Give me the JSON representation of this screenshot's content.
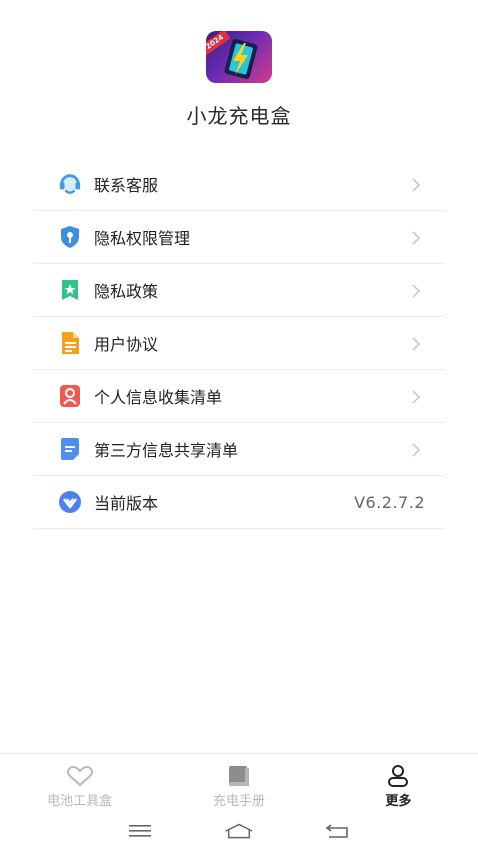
{
  "app": {
    "name": "小龙充电盒",
    "logo_badge": "2024"
  },
  "menu": [
    {
      "label": "联系客服",
      "icon": "headset-icon",
      "color": "#3b9be8"
    },
    {
      "label": "隐私权限管理",
      "icon": "shield-icon",
      "color": "#3a8ee6"
    },
    {
      "label": "隐私政策",
      "icon": "bookmark-star-icon",
      "color": "#2fc387"
    },
    {
      "label": "用户协议",
      "icon": "document-icon",
      "color": "#f5a020"
    },
    {
      "label": "个人信息收集清单",
      "icon": "person-card-icon",
      "color": "#ee5a4f"
    },
    {
      "label": "第三方信息共享清单",
      "icon": "note-icon",
      "color": "#4f8ef0"
    },
    {
      "label": "当前版本",
      "icon": "version-icon",
      "color": "#4f7ff0",
      "value": "V6.2.7.2"
    }
  ],
  "tabs": [
    {
      "label": "电池工具盒",
      "icon": "heart-icon"
    },
    {
      "label": "充电手册",
      "icon": "book-icon"
    },
    {
      "label": "更多",
      "icon": "user-icon",
      "active": true
    }
  ],
  "colors": {
    "inactive": "#b8b8b8",
    "active": "#222222",
    "chevron": "#c4c4c4"
  }
}
